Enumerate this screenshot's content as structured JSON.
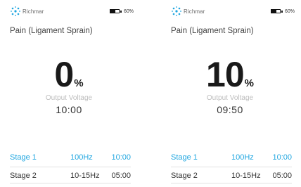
{
  "brand": "Richmar",
  "accent_color": "#1fa6e0",
  "screens": [
    {
      "battery_text": "60%",
      "battery_level": 0.6,
      "protocol": "Pain (Ligament Sprain)",
      "value": "0",
      "unit": "%",
      "label": "Output Voltage",
      "timer": "10:00",
      "stages": [
        {
          "name": "Stage 1",
          "freq": "100Hz",
          "time": "10:00",
          "active": true
        },
        {
          "name": "Stage 2",
          "freq": "10-15Hz",
          "time": "05:00",
          "active": false
        }
      ]
    },
    {
      "battery_text": "60%",
      "battery_level": 0.6,
      "protocol": "Pain (Ligament Sprain)",
      "value": "10",
      "unit": "%",
      "label": "Output Voltage",
      "timer": "09:50",
      "stages": [
        {
          "name": "Stage 1",
          "freq": "100Hz",
          "time": "10:00",
          "active": true
        },
        {
          "name": "Stage 2",
          "freq": "10-15Hz",
          "time": "05:00",
          "active": false
        }
      ]
    }
  ]
}
